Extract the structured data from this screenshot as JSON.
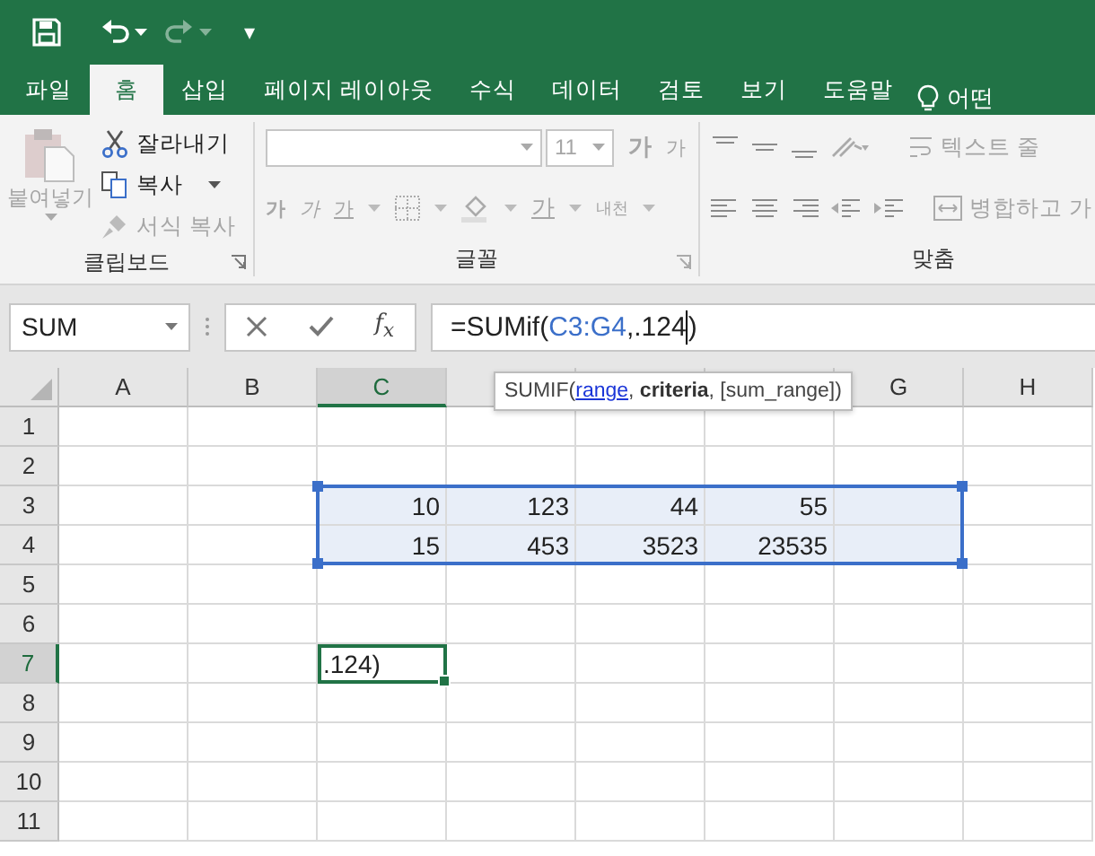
{
  "quick_access": {
    "customize": "▾"
  },
  "tabs": [
    {
      "label": "파일",
      "selected": false
    },
    {
      "label": "홈",
      "selected": true
    },
    {
      "label": "삽입",
      "selected": false
    },
    {
      "label": "페이지 레이아웃",
      "selected": false
    },
    {
      "label": "수식",
      "selected": false
    },
    {
      "label": "데이터",
      "selected": false
    },
    {
      "label": "검토",
      "selected": false
    },
    {
      "label": "보기",
      "selected": false
    },
    {
      "label": "도움말",
      "selected": false
    }
  ],
  "tell_me": "어떤",
  "ribbon": {
    "clipboard": {
      "label": "클립보드",
      "paste": {
        "label": "붙여넣기",
        "disabled": true
      },
      "cut": {
        "label": "잘라내기",
        "disabled": false
      },
      "copy": {
        "label": "복사",
        "disabled": false
      },
      "format_painter": {
        "label": "서식 복사",
        "disabled": true
      }
    },
    "font": {
      "label": "글꼴",
      "disabled": true,
      "size": "11",
      "grow": "가",
      "shrink": "가",
      "bold": "가",
      "italic": "가",
      "underline": "가",
      "font_color": "가",
      "phonetic": "내천"
    },
    "alignment": {
      "label": "맞춤",
      "disabled": true,
      "wrap_text": "텍스트 줄",
      "merge": "병합하고 가"
    }
  },
  "name_box": "SUM",
  "formula_bar": {
    "fx": "f$_{x}$",
    "parts": [
      {
        "kind": "text",
        "text": "=SUMif("
      },
      {
        "kind": "ref",
        "text": "C3:G4"
      },
      {
        "kind": "text",
        "text": ",.124"
      },
      {
        "kind": "caret"
      },
      {
        "kind": "text",
        "text": ")"
      }
    ]
  },
  "tooltip": {
    "parts": [
      {
        "kind": "text",
        "text": "SUMIF("
      },
      {
        "kind": "link",
        "text": "range"
      },
      {
        "kind": "text",
        "text": ", "
      },
      {
        "kind": "bold",
        "text": "criteria"
      },
      {
        "kind": "text",
        "text": ", [sum_range])"
      }
    ]
  },
  "columns": [
    {
      "label": "A",
      "selected": false
    },
    {
      "label": "B",
      "selected": false
    },
    {
      "label": "C",
      "selected": true
    },
    {
      "selected": false
    },
    {
      "selected": false
    },
    {
      "selected": false
    },
    {
      "label": "G",
      "selected": false
    },
    {
      "label": "H",
      "selected": false
    }
  ],
  "rows": [
    {
      "label": "1",
      "selected": false,
      "cells": []
    },
    {
      "label": "2",
      "selected": false,
      "cells": []
    },
    {
      "label": "3",
      "selected": false,
      "cells": [
        null,
        null,
        {
          "value": "10",
          "in_range": true
        },
        {
          "value": "123",
          "in_range": true
        },
        {
          "value": "44",
          "in_range": true
        },
        {
          "value": "55",
          "in_range": true
        },
        {
          "in_range": true
        }
      ]
    },
    {
      "label": "4",
      "selected": false,
      "cells": [
        null,
        null,
        {
          "value": "15",
          "in_range": true
        },
        {
          "value": "453",
          "in_range": true
        },
        {
          "value": "3523",
          "in_range": true
        },
        {
          "value": "23535",
          "in_range": true
        },
        {
          "in_range": true
        }
      ]
    },
    {
      "label": "5",
      "selected": false,
      "cells": []
    },
    {
      "label": "6",
      "selected": false,
      "cells": []
    },
    {
      "label": "7",
      "selected": true,
      "cells": [
        null,
        null,
        {
          "value": ".124)",
          "active": true
        }
      ]
    },
    {
      "label": "8",
      "selected": false,
      "cells": []
    },
    {
      "label": "9",
      "selected": false,
      "cells": []
    },
    {
      "label": "10",
      "selected": false,
      "cells": []
    },
    {
      "label": "11",
      "selected": false,
      "cells": []
    }
  ]
}
